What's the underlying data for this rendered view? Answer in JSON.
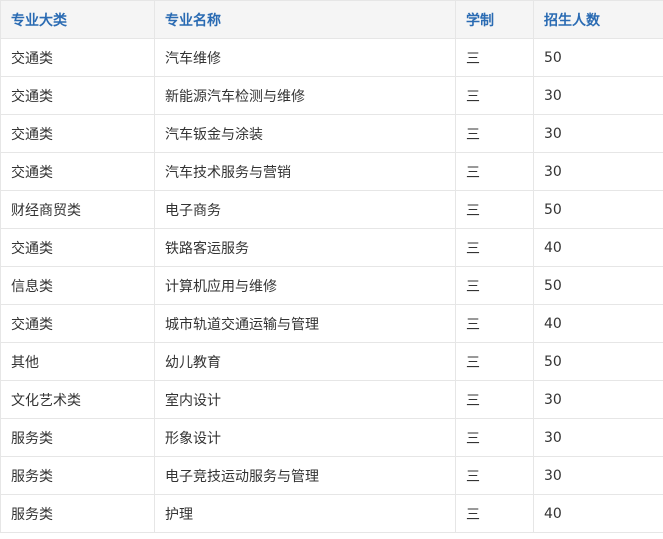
{
  "table": {
    "headers": [
      "专业大类",
      "专业名称",
      "学制",
      "招生人数"
    ],
    "rows": [
      [
        "交通类",
        "汽车维修",
        "三",
        "50"
      ],
      [
        "交通类",
        "新能源汽车检测与维修",
        "三",
        "30"
      ],
      [
        "交通类",
        "汽车钣金与涂装",
        "三",
        "30"
      ],
      [
        "交通类",
        "汽车技术服务与营销",
        "三",
        "30"
      ],
      [
        "财经商贸类",
        "电子商务",
        "三",
        "50"
      ],
      [
        "交通类",
        "铁路客运服务",
        "三",
        "40"
      ],
      [
        "信息类",
        "计算机应用与维修",
        "三",
        "50"
      ],
      [
        "交通类",
        "城市轨道交通运输与管理",
        "三",
        "40"
      ],
      [
        "其他",
        "幼儿教育",
        "三",
        "50"
      ],
      [
        "文化艺术类",
        "室内设计",
        "三",
        "30"
      ],
      [
        "服务类",
        "形象设计",
        "三",
        "30"
      ],
      [
        "服务类",
        "电子竞技运动服务与管理",
        "三",
        "30"
      ],
      [
        "服务类",
        "护理",
        "三",
        "40"
      ]
    ]
  },
  "colors": {
    "header_text": "#2a6bb3",
    "header_background": "#f5f5f5",
    "body_text": "#333333",
    "border": "#e6e6e6"
  }
}
